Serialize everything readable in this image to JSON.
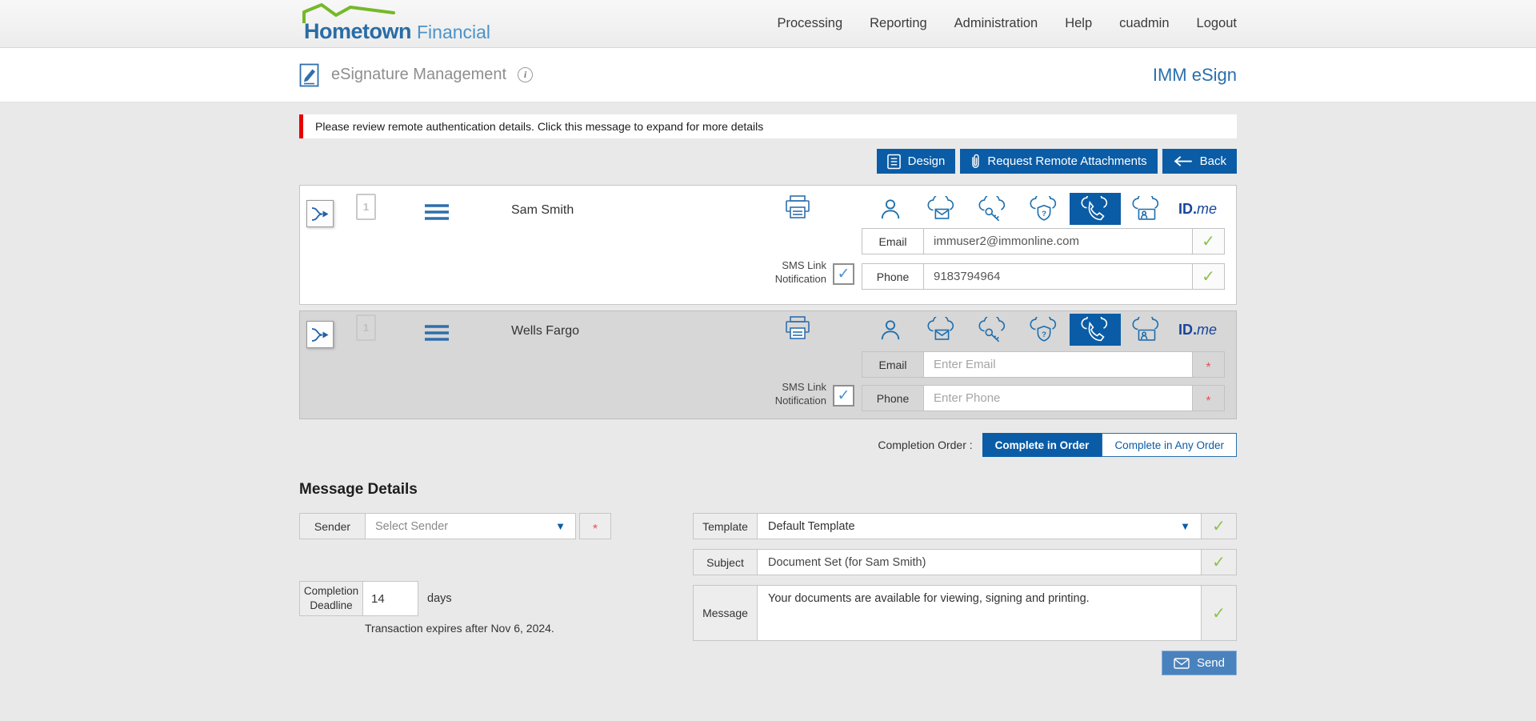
{
  "brand": {
    "name": "Hometown",
    "suffix": "Financial"
  },
  "nav_items": [
    "Processing",
    "Reporting",
    "Administration",
    "Help",
    "cuadmin",
    "Logout"
  ],
  "header": {
    "title": "eSignature Management",
    "product": "IMM eSign",
    "info_glyph": "i"
  },
  "alert": {
    "text": "Please review remote authentication details. Click this message to expand for more details"
  },
  "toolbar": {
    "design": "Design",
    "request_remote_attachments": "Request Remote Attachments",
    "back": "Back"
  },
  "recipients": [
    {
      "name": "Sam Smith",
      "doc_count": "1",
      "email": {
        "label": "Email",
        "value": "immuser2@immonline.com"
      },
      "phone": {
        "label": "Phone",
        "value": "9183794964"
      },
      "sms_label": "SMS Link Notification"
    },
    {
      "name": "Wells Fargo",
      "doc_count": "1",
      "email": {
        "label": "Email",
        "placeholder": "Enter Email"
      },
      "phone": {
        "label": "Phone",
        "placeholder": "Enter Phone"
      },
      "sms_label": "SMS Link Notification"
    }
  ],
  "idme": {
    "bold": "ID.",
    "italic": "me"
  },
  "completion_order": {
    "label": "Completion Order :",
    "selected": "Complete in Order",
    "other": "Complete in Any Order"
  },
  "message_details": {
    "heading": "Message Details",
    "sender": {
      "label": "Sender",
      "placeholder": "Select Sender"
    },
    "deadline": {
      "label": "Completion Deadline",
      "value": "14",
      "unit": "days",
      "note": "Transaction expires after Nov 6, 2024."
    },
    "template": {
      "label": "Template",
      "value": "Default Template"
    },
    "subject": {
      "label": "Subject",
      "value": "Document Set (for Sam Smith)"
    },
    "message": {
      "label": "Message",
      "value": "Your documents are available for viewing, signing and printing."
    },
    "send": "Send"
  },
  "glyphs": {
    "check": "✓",
    "asterisk": "*",
    "caret": "▼"
  },
  "colors": {
    "accent_blue": "#0a5ca6",
    "icon_blue": "#1e6fad",
    "green_check": "#8bc34a",
    "alert_red": "#e60000",
    "logo_green": "#76b82a",
    "logo_blue": "#2a6ca5",
    "logo_light_blue": "#4b93c8",
    "panel_gray": "#d7d7d7",
    "send_blue": "#4a82bd",
    "idme_blue": "#16459c"
  }
}
